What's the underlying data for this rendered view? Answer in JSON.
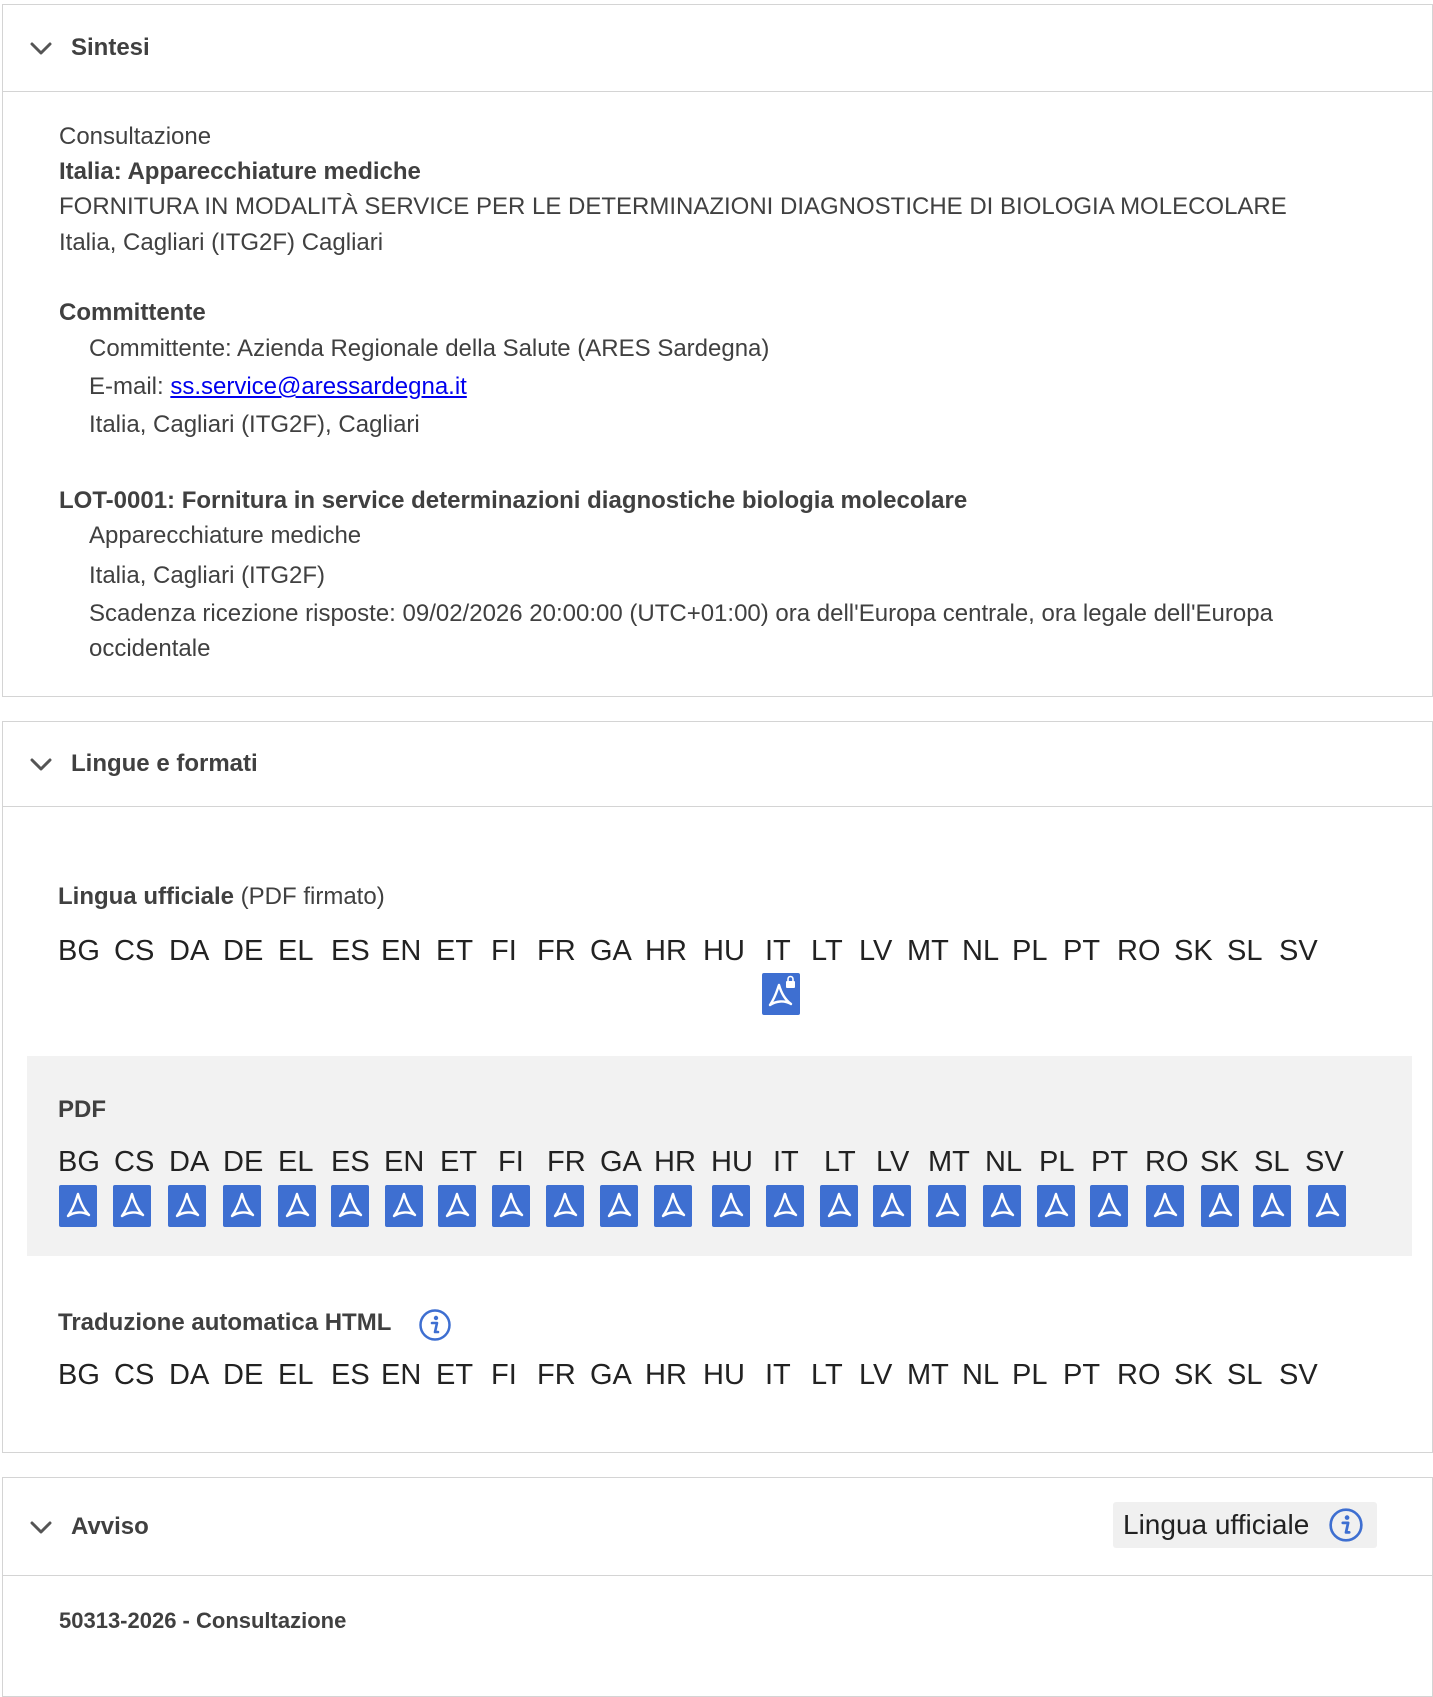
{
  "sections": {
    "sintesi": {
      "title": "Sintesi",
      "type_line": "Consultazione",
      "subject": "Italia: Apparecchiature mediche",
      "description": "FORNITURA IN MODALITÀ SERVICE PER LE DETERMINAZIONI DIAGNOSTICHE DI BIOLOGIA MOLECOLARE",
      "place": "Italia, Cagliari (ITG2F) Cagliari",
      "buyer_heading": "Committente",
      "buyer_name": "Committente: Azienda Regionale della Salute (ARES Sardegna)",
      "email_label": "E-mail: ",
      "email": "ss.service@aressardegna.it",
      "buyer_place": "Italia, Cagliari (ITG2F), Cagliari",
      "lot_title": "LOT-0001: Fornitura in service determinazioni diagnostiche biologia molecolare",
      "lot_category": "Apparecchiature mediche",
      "lot_place": "Italia, Cagliari (ITG2F)",
      "lot_deadline_1": "Scadenza ricezione risposte: 09/02/2026 20:00:00 (UTC+01:00) ora dell'Europa centrale, ora legale dell'Europa",
      "lot_deadline_2": "occidentale"
    },
    "lingue": {
      "title": "Lingue e formati",
      "official_label": "Lingua ufficiale",
      "official_suffix": " (PDF firmato)",
      "pdf_label": "PDF",
      "html_label": "Traduzione automatica HTML",
      "languages": [
        "BG",
        "CS",
        "DA",
        "DE",
        "EL",
        "ES",
        "EN",
        "ET",
        "FI",
        "FR",
        "GA",
        "HR",
        "HU",
        "IT",
        "LT",
        "LV",
        "MT",
        "NL",
        "PL",
        "PT",
        "RO",
        "SK",
        "SL",
        "SV"
      ],
      "signed_pdf_language": "IT"
    },
    "avviso": {
      "title": "Avviso",
      "badge_label": "Lingua ufficiale",
      "notice_id": "50313-2026 - Consultazione"
    }
  },
  "icons": {
    "chevron": "chevron-down-icon",
    "pdf": "pdf-icon",
    "signed_pdf": "pdf-lock-icon",
    "info": "info-icon"
  },
  "colors": {
    "pdf_icon": "#3e6fd1",
    "link": "#0000ee",
    "info": "#3e6fd1"
  }
}
